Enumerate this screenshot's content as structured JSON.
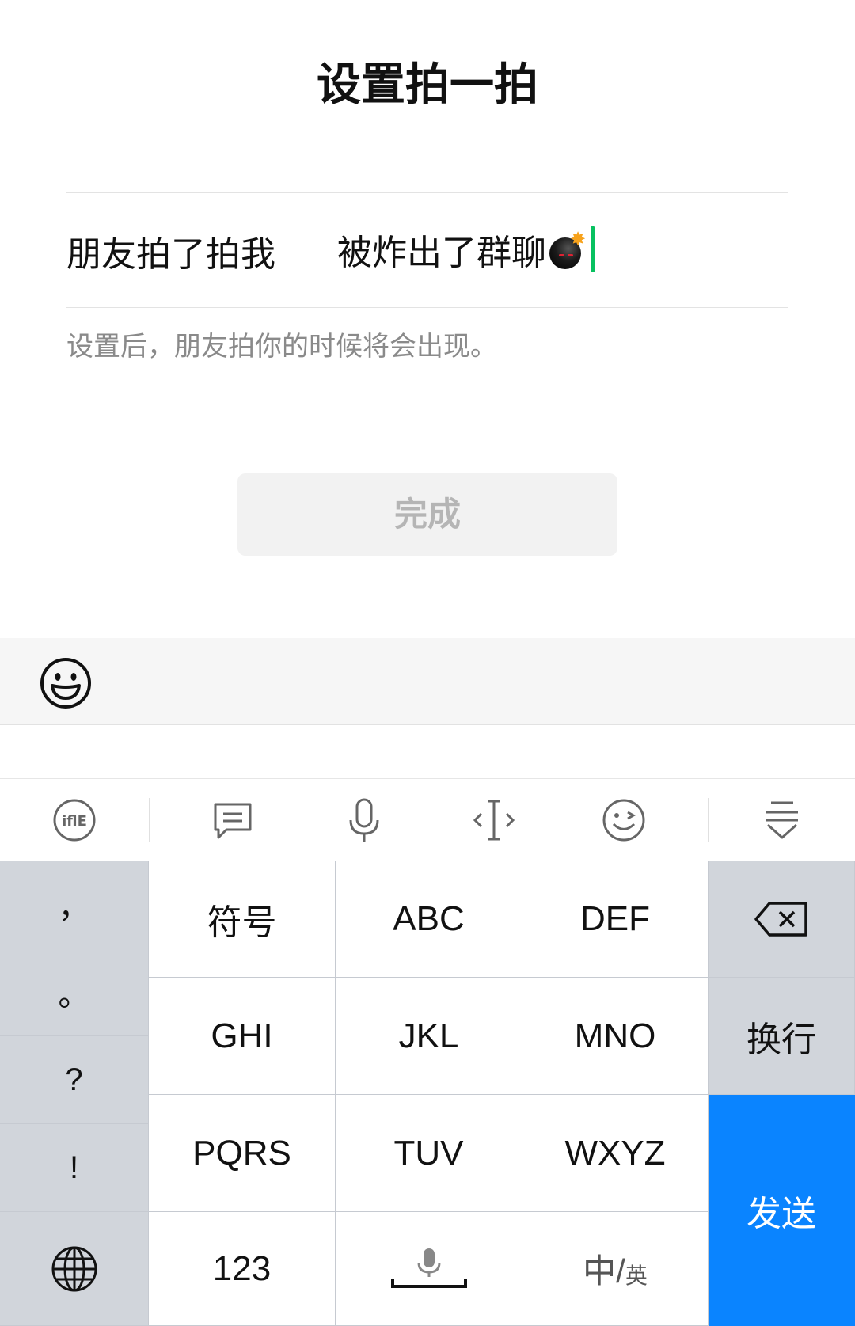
{
  "page": {
    "title": "设置拍一拍",
    "label": "朋友拍了拍我",
    "input_value": "被炸出了群聊",
    "input_emoji": "bomb-emoji",
    "hint": "设置后，朋友拍你的时候将会出现。",
    "done_label": "完成"
  },
  "emoji_bar": {
    "icon": "smiley-face-icon"
  },
  "toolbar": {
    "icons": [
      "ifly-logo-icon",
      "message-icon",
      "microphone-icon",
      "cursor-move-icon",
      "wink-emoji-icon",
      "collapse-keyboard-icon"
    ]
  },
  "keyboard": {
    "punctuation": [
      "，",
      "。",
      "?",
      "!"
    ],
    "globe_icon": "globe-icon",
    "row1": [
      "符号",
      "ABC",
      "DEF"
    ],
    "row2": [
      "GHI",
      "JKL",
      "MNO"
    ],
    "row3": [
      "PQRS",
      "TUV",
      "WXYZ"
    ],
    "row4": {
      "numbers": "123",
      "space_icon": "space-mic-icon",
      "lang_main": "中/",
      "lang_sub": "英"
    },
    "backspace_icon": "backspace-icon",
    "newline": "换行",
    "send": "发送"
  },
  "colors": {
    "accent_green": "#07c160",
    "send_blue": "#0a84ff"
  }
}
